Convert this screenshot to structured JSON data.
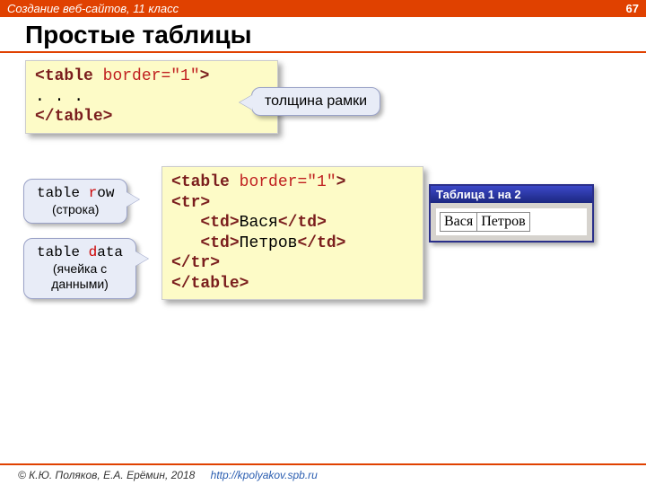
{
  "header": {
    "course": "Создание веб-сайтов, 11 класс",
    "page": "67",
    "title": "Простые таблицы"
  },
  "code1": {
    "open_lt": "<",
    "open_el": "table",
    "open_sp": " ",
    "open_attr": "border=\"1\"",
    "open_gt": ">",
    "body": ". . .",
    "close_lt": "</",
    "close_el": "table",
    "close_gt": ">"
  },
  "callouts": {
    "border": "толщина рамки",
    "row_term": "table ",
    "row_letter": "r",
    "row_rest": "ow",
    "row_tr": "(строка)",
    "data_term": "table ",
    "data_letter": "d",
    "data_rest": "ata",
    "data_tr": "(ячейка с\nданными)"
  },
  "code2": {
    "l1_a": "<",
    "l1_b": "table",
    "l1_c": " ",
    "l1_d": "border=\"1\"",
    "l1_e": ">",
    "l2_a": "<",
    "l2_b": "tr",
    "l2_c": ">",
    "l3_a": "   <",
    "l3_b": "td",
    "l3_c": ">",
    "l3_d": "Вася",
    "l3_e": "</",
    "l3_f": "td",
    "l3_g": ">",
    "l4_a": "   <",
    "l4_b": "td",
    "l4_c": ">",
    "l4_d": "Петров",
    "l4_e": "</",
    "l4_f": "td",
    "l4_g": ">",
    "l5_a": "</",
    "l5_b": "tr",
    "l5_c": ">",
    "l6_a": "</",
    "l6_b": "table",
    "l6_c": ">"
  },
  "window": {
    "title": "Таблица 1 на 2",
    "cell1": "Вася",
    "cell2": "Петров"
  },
  "footer": {
    "copyright": "© К.Ю. Поляков, Е.А. Ерёмин, 2018",
    "url": "http://kpolyakov.spb.ru"
  }
}
